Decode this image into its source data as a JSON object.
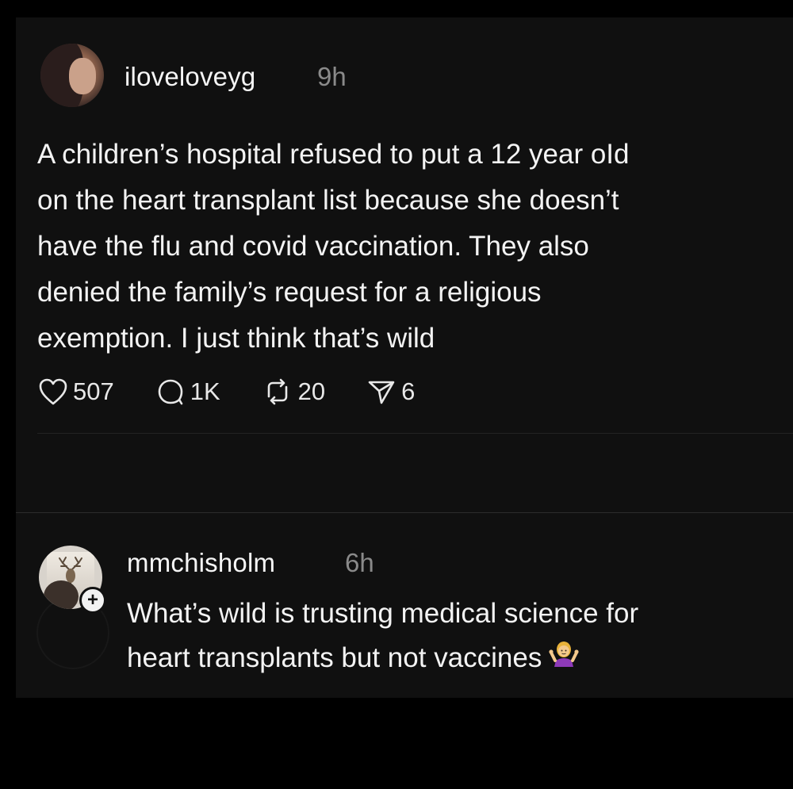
{
  "post": {
    "username": "iloveloveyg",
    "time": "9h",
    "text": "A children’s hospital refused to put a 12 year oId\non the heart transplant list because she doesn’t\nhave the flu and covid vaccination. They also\ndenied the family’s request for a religious\nexemption. I just think that’s wild",
    "actions": {
      "likes": "507",
      "replies": "1K",
      "reposts": "20",
      "shares": "6"
    }
  },
  "reply": {
    "username": "mmchisholm",
    "time": "6h",
    "text": "What’s wild is trusting medical science for\nheart transplants but not vaccines",
    "emoji": "person-shrugging-emoji",
    "follow_badge": "+"
  },
  "icons": {
    "like": "heart-icon",
    "reply": "comment-bubble-icon",
    "repost": "repost-arrows-icon",
    "share": "send-paper-plane-icon"
  },
  "colors": {
    "background": "#000000",
    "panel": "#101010",
    "text": "#f3f3f3",
    "muted": "#8a8a8a"
  }
}
